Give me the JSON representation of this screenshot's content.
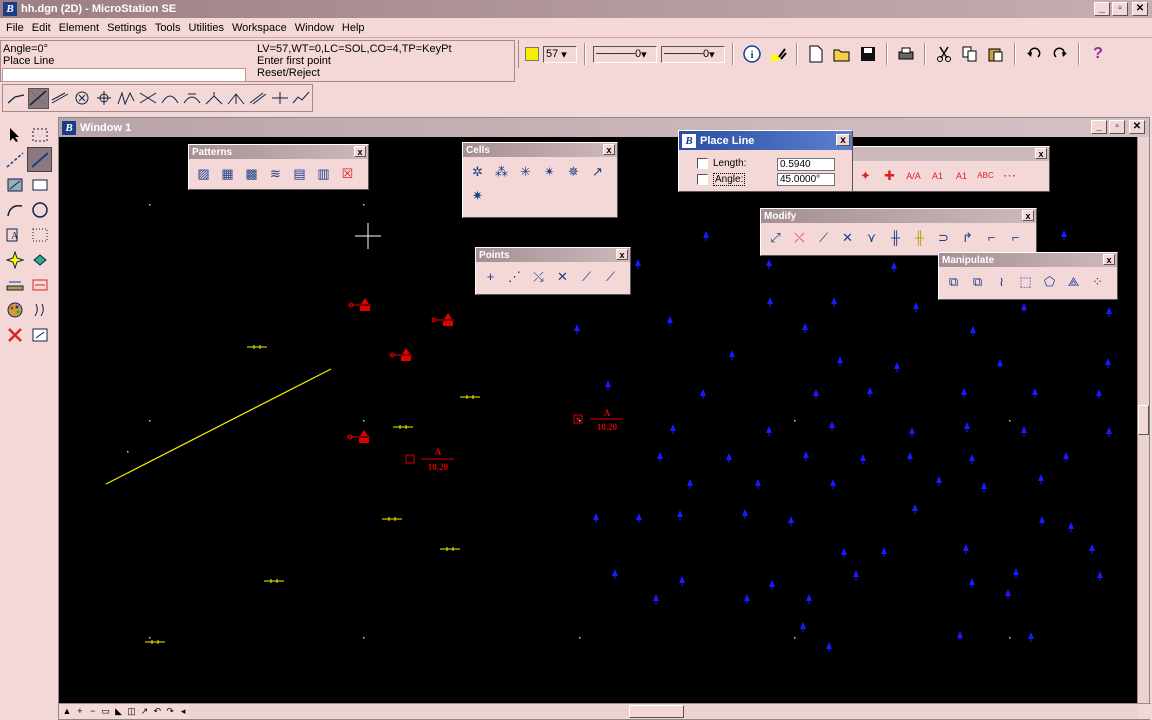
{
  "app": {
    "title": "hh.dgn (2D) - MicroStation SE",
    "logo_letter": "B",
    "min": "_",
    "max": "▫",
    "close": "✕"
  },
  "menu": [
    "File",
    "Edit",
    "Element",
    "Settings",
    "Tools",
    "Utilities",
    "Workspace",
    "Window",
    "Help"
  ],
  "status": {
    "angle": "Angle=0°",
    "tool": "Place Line",
    "attrs": "LV=57,WT=0,LC=SOL,CO=4,TP=KeyPt",
    "prompt": "Enter first point",
    "reset": "Reset/Reject"
  },
  "attributes": {
    "color_value": "#f5f000",
    "level": "57",
    "style": "0",
    "weight": "0"
  },
  "window1": {
    "title": "Window 1"
  },
  "palettes": {
    "patterns": "Patterns",
    "cells": "Cells",
    "points": "Points",
    "modify": "Modify",
    "manipulate": "Manipulate",
    "close": "x"
  },
  "place_line": {
    "title": "Place Line",
    "length_label": "Length:",
    "length_value": "0.5940",
    "angle_label": "Angle:",
    "angle_value": "45.0000°"
  },
  "drawing": {
    "red_label_letter": "A",
    "red_label_value": "10.20",
    "line_color": "#f5f000",
    "red_color": "#e00000",
    "blue_color": "#1a1aff"
  }
}
